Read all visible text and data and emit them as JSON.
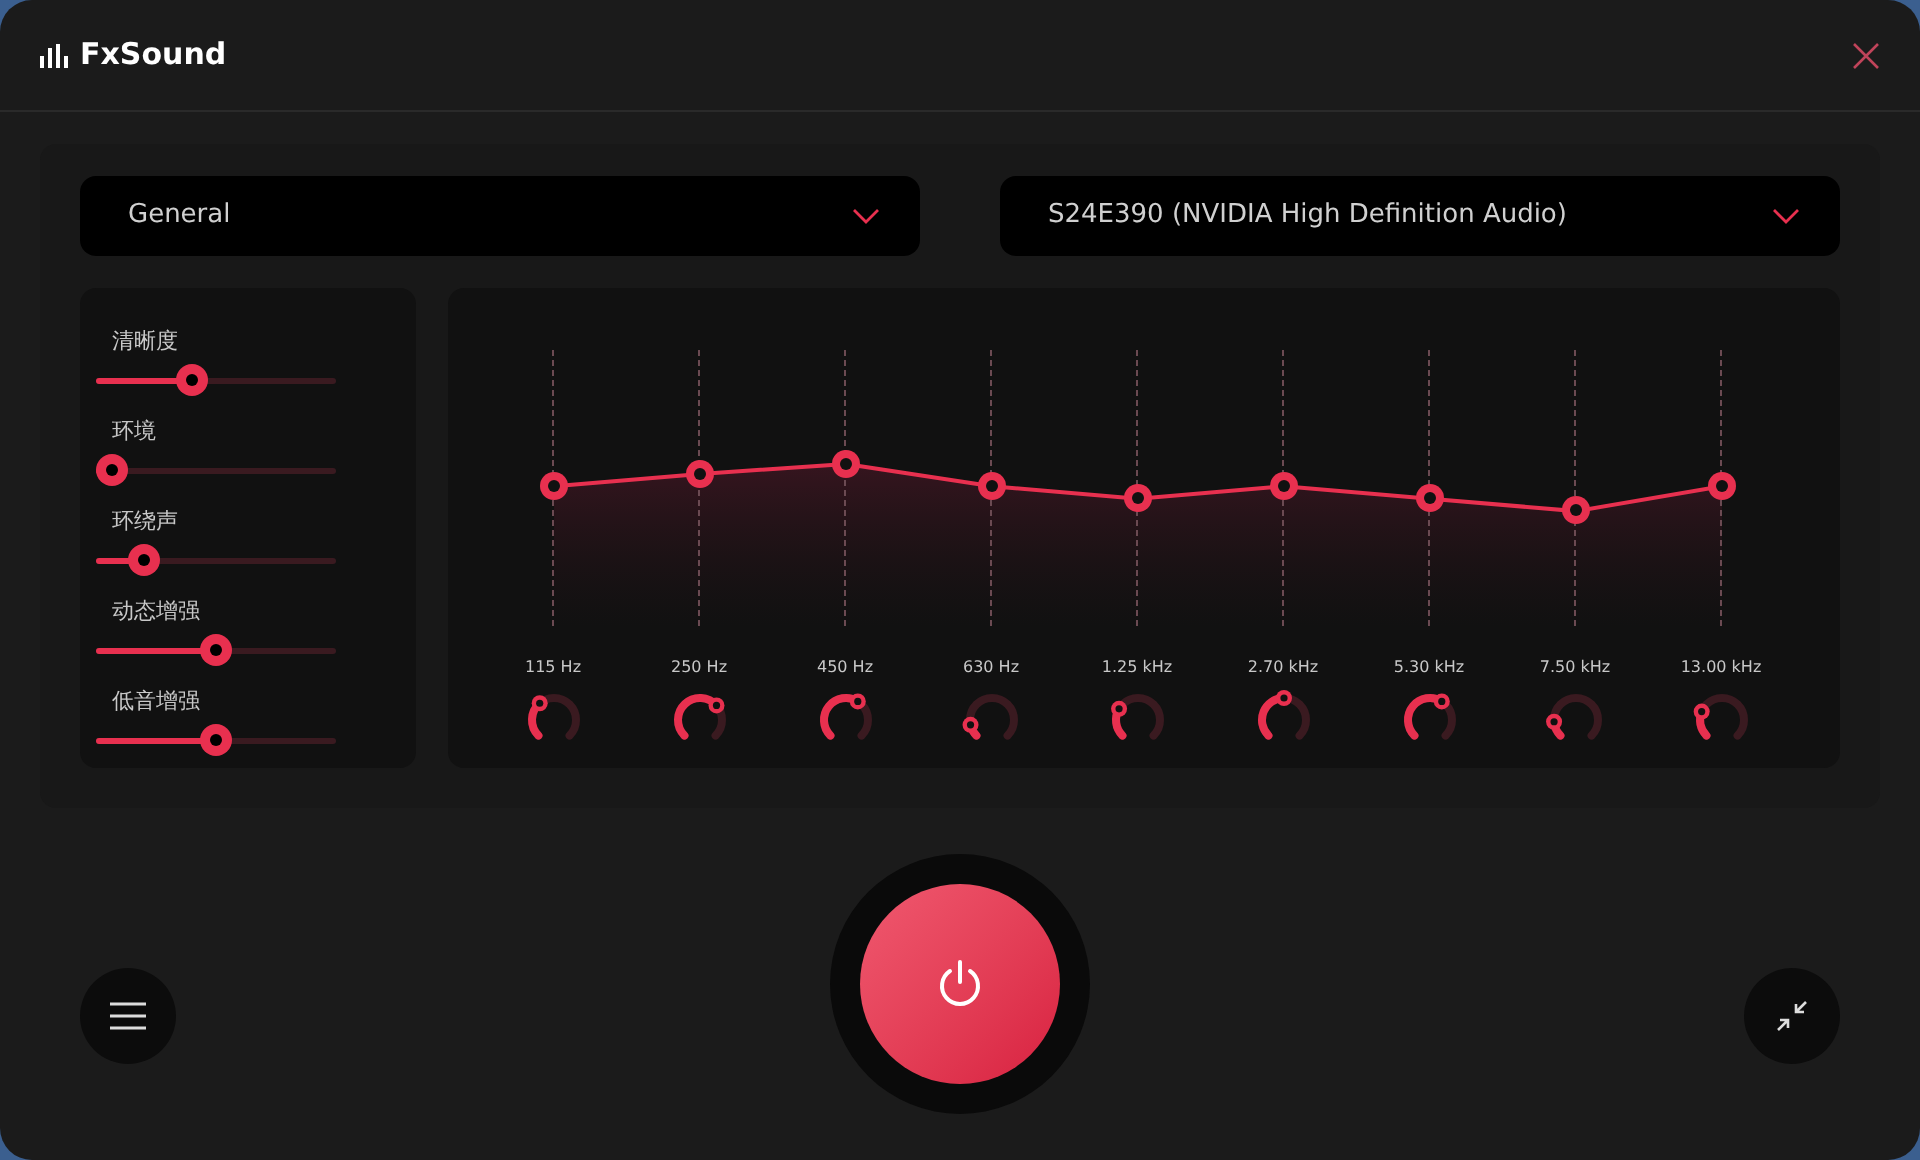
{
  "app": {
    "title": "FxSound"
  },
  "preset": {
    "value": "General"
  },
  "device": {
    "value": "S24E390 (NVIDIA High Definition Audio)"
  },
  "effects": [
    {
      "label": "清晰度"
    },
    {
      "label": "环境"
    },
    {
      "label": "环绕声"
    },
    {
      "label": "动态增强"
    },
    {
      "label": "低音增强"
    }
  ],
  "bands": [
    {
      "label": "115 Hz"
    },
    {
      "label": "250 Hz"
    },
    {
      "label": "450 Hz"
    },
    {
      "label": "630 Hz"
    },
    {
      "label": "1.25 kHz"
    },
    {
      "label": "2.70 kHz"
    },
    {
      "label": "5.30 kHz"
    },
    {
      "label": "7.50 kHz"
    },
    {
      "label": "13.00 kHz"
    }
  ],
  "power": {
    "on": true
  }
}
